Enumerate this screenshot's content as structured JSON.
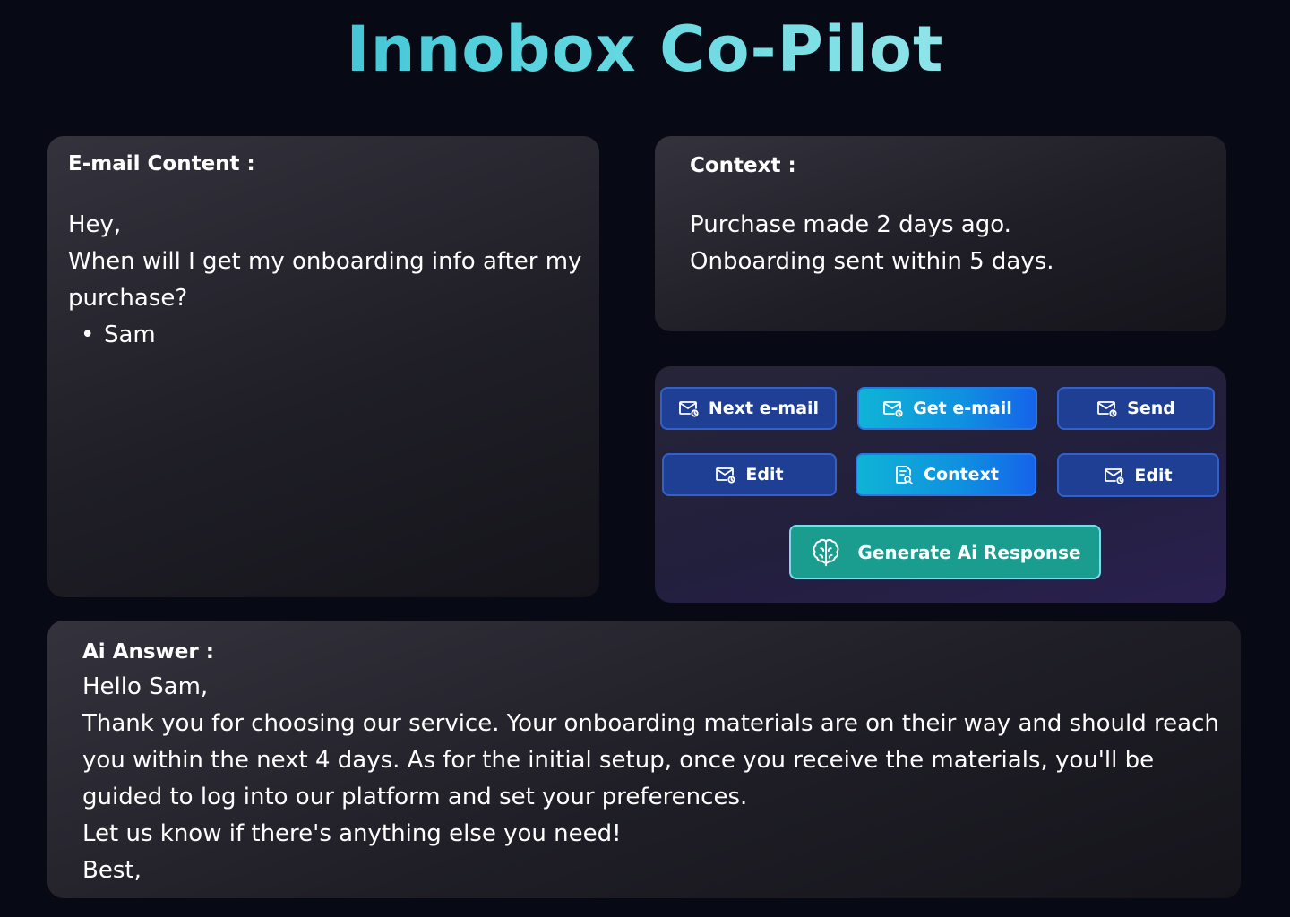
{
  "app": {
    "title": "Innobox Co-Pilot"
  },
  "email": {
    "label": "E-mail Content :",
    "greeting": "Hey,",
    "body": "When will I get my onboarding info after my purchase?",
    "signature": "Sam"
  },
  "context": {
    "label": "Context :",
    "lines": [
      "Purchase made 2 days ago.",
      "Onboarding sent within 5 days."
    ]
  },
  "actions": {
    "next_email": "Next e-mail",
    "get_email": "Get e-mail",
    "send": "Send",
    "edit_email": "Edit",
    "context": "Context",
    "edit_answer": "Edit",
    "generate": "Generate Ai Response",
    "icons": {
      "mail": "mail-sync-icon",
      "context": "document-search-icon",
      "generate": "ai-brain-icon"
    }
  },
  "answer": {
    "label": "Ai Answer :",
    "lines": [
      "Hello Sam,",
      "Thank you for choosing our service. Your onboarding materials are on their way and should reach you within the next 4 days. As for the initial setup, once you receive the materials, you'll be guided to log into our platform and set your preferences.",
      "Let us know if there's anything else you need!",
      "Best,"
    ]
  },
  "colors": {
    "background": "#070a14",
    "title_gradient_start": "#1fb0c8",
    "title_gradient_end": "#bdf1f0",
    "button_dark": "#1e3f93",
    "button_bright": "#0fb4d6",
    "button_generate": "#1a9d8f"
  }
}
